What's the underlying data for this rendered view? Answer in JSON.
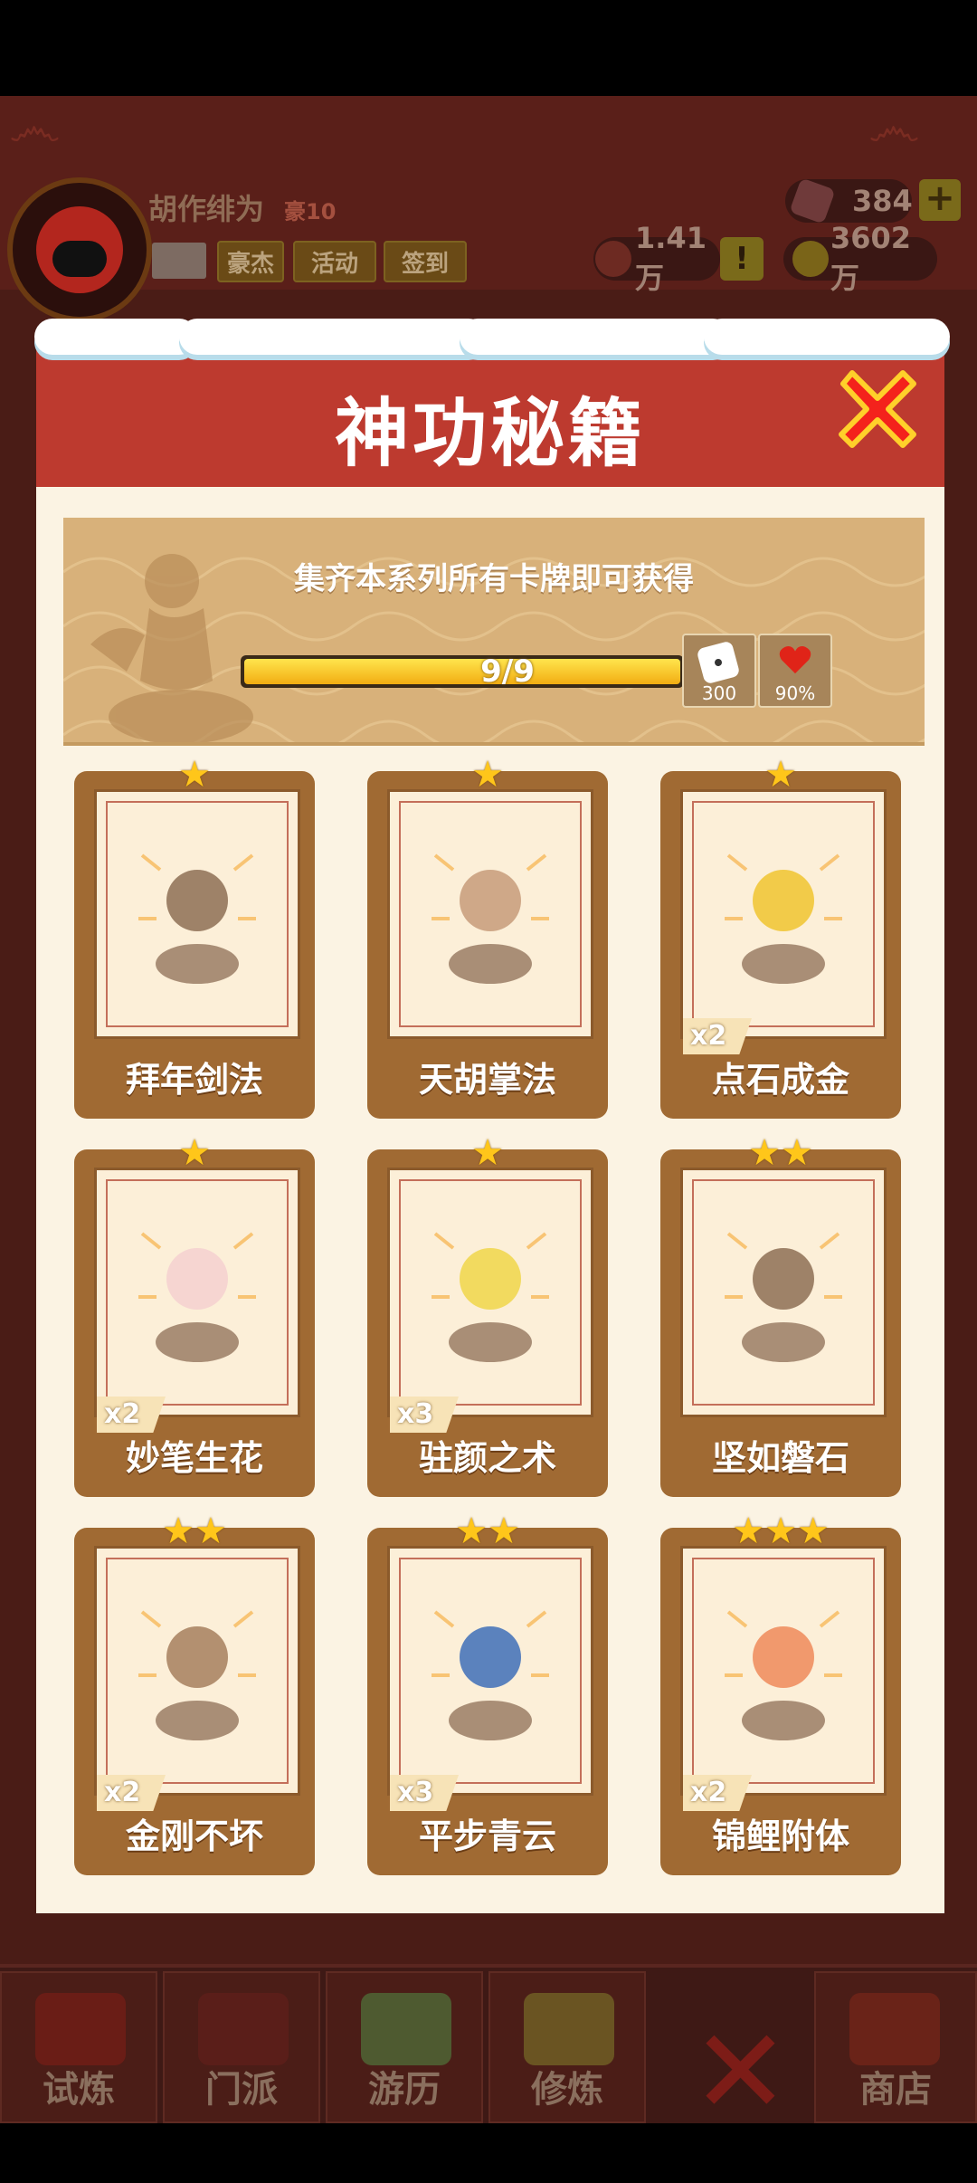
{
  "player": {
    "name": "胡作绯为",
    "rank": "豪10"
  },
  "header_buttons": {
    "rank_badge": "豪杰",
    "activity": "活动",
    "checkin": "签到"
  },
  "currencies": {
    "gems": "384",
    "power": "1.41万",
    "coins": "3602万"
  },
  "modal": {
    "title": "神功秘籍",
    "banner_text": "集齐本系列所有卡牌即可获得",
    "progress": {
      "current": 9,
      "total": 9,
      "label": "9/9"
    },
    "rewards": [
      {
        "icon": "dice-icon",
        "label": "300"
      },
      {
        "icon": "heart-icon",
        "label": "90%"
      }
    ]
  },
  "cards": [
    {
      "name": "拜年剑法",
      "stars": "★",
      "count": ""
    },
    {
      "name": "天胡掌法",
      "stars": "★",
      "count": ""
    },
    {
      "name": "点石成金",
      "stars": "★",
      "count": "x2"
    },
    {
      "name": "妙笔生花",
      "stars": "★",
      "count": "x2"
    },
    {
      "name": "驻颜之术",
      "stars": "★",
      "count": "x3"
    },
    {
      "name": "坚如磐石",
      "stars": "★★",
      "count": ""
    },
    {
      "name": "金刚不坏",
      "stars": "★★",
      "count": "x2"
    },
    {
      "name": "平步青云",
      "stars": "★★",
      "count": "x3"
    },
    {
      "name": "锦鲤附体",
      "stars": "★★★",
      "count": "x2"
    }
  ],
  "bottom_nav": [
    {
      "label": "试炼"
    },
    {
      "label": "门派"
    },
    {
      "label": "游历"
    },
    {
      "label": "修炼"
    },
    {
      "label": "商店"
    }
  ],
  "colors": {
    "modal_header": "#bd3a2f",
    "card": "#a06a33",
    "star": "#ffc61a",
    "progress": "#f2ad12"
  }
}
